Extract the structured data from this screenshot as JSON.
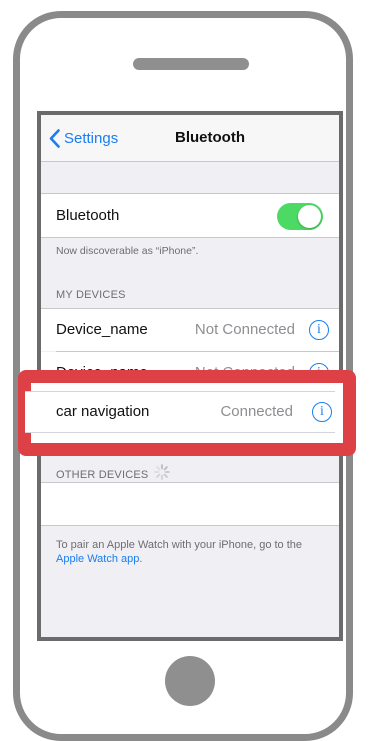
{
  "nav": {
    "back_label": "Settings",
    "title": "Bluetooth"
  },
  "bluetooth": {
    "label": "Bluetooth",
    "enabled": true,
    "toggle_color": "#4cd964",
    "discoverable_text": "Now discoverable as “iPhone”."
  },
  "my_devices": {
    "header": "MY DEVICES",
    "items": [
      {
        "name": "Device_name",
        "status": "Not Connected"
      },
      {
        "name": "Device_name",
        "status": "Not Connected"
      }
    ]
  },
  "highlighted_device": {
    "name": "car navigation",
    "status": "Connected",
    "highlight_color": "#de4145"
  },
  "other_devices": {
    "header": "OTHER DEVICES",
    "spinner_icon": "activity-spinner-icon"
  },
  "footer": {
    "text": "To pair an Apple Watch with your iPhone, go to the ",
    "link": "Apple Watch app",
    "suffix": "."
  },
  "icons": {
    "back": "chevron-left-icon",
    "info": "info-circle-icon",
    "info_glyph": "i"
  },
  "colors": {
    "accent": "#1a7ef2",
    "background": "#efeff4"
  }
}
